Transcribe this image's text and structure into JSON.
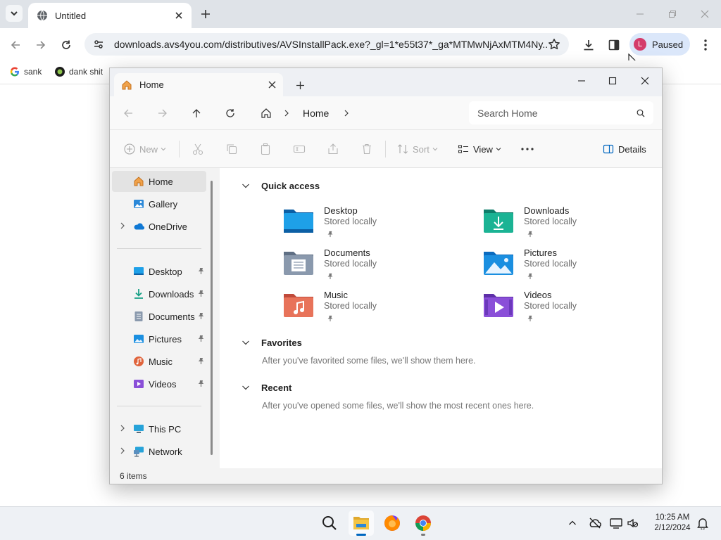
{
  "browser": {
    "tab_title": "Untitled",
    "url": "downloads.avs4you.com/distributives/AVSInstallPack.exe?_gl=1*e55t37*_ga*MTMwNjAxMTM4Ny...",
    "profile_initial": "L",
    "profile_status": "Paused",
    "bookmarks": [
      {
        "label": "sank",
        "icon": "google-icon"
      },
      {
        "label": "dank shit",
        "icon": "bookmark-site-icon"
      }
    ]
  },
  "explorer": {
    "tab_title": "Home",
    "breadcrumb": "Home",
    "search_placeholder": "Search Home",
    "commands": {
      "new": "New",
      "sort": "Sort",
      "view": "View",
      "details": "Details"
    },
    "sidebar": {
      "top": [
        {
          "label": "Home",
          "icon": "home-icon"
        },
        {
          "label": "Gallery",
          "icon": "gallery-icon"
        },
        {
          "label": "OneDrive",
          "icon": "onedrive-icon"
        }
      ],
      "pinned": [
        {
          "label": "Desktop",
          "icon": "desktop-icon"
        },
        {
          "label": "Downloads",
          "icon": "downloads-icon"
        },
        {
          "label": "Documents",
          "icon": "documents-icon"
        },
        {
          "label": "Pictures",
          "icon": "pictures-icon"
        },
        {
          "label": "Music",
          "icon": "music-icon"
        },
        {
          "label": "Videos",
          "icon": "videos-icon"
        }
      ],
      "bottom": [
        {
          "label": "This PC",
          "icon": "this-pc-icon"
        },
        {
          "label": "Network",
          "icon": "network-icon"
        }
      ]
    },
    "sections": {
      "quick_access": {
        "title": "Quick access",
        "items": [
          {
            "name": "Desktop",
            "status": "Stored locally"
          },
          {
            "name": "Downloads",
            "status": "Stored locally"
          },
          {
            "name": "Documents",
            "status": "Stored locally"
          },
          {
            "name": "Pictures",
            "status": "Stored locally"
          },
          {
            "name": "Music",
            "status": "Stored locally"
          },
          {
            "name": "Videos",
            "status": "Stored locally"
          }
        ]
      },
      "favorites": {
        "title": "Favorites",
        "message": "After you've favorited some files, we'll show them here."
      },
      "recent": {
        "title": "Recent",
        "message": "After you've opened some files, we'll show the most recent ones here."
      }
    },
    "status": "6 items"
  },
  "taskbar": {
    "time": "10:25 AM",
    "date": "2/12/2024"
  },
  "colors": {
    "accent": "#0067c0",
    "chrome_frame": "#dfe3e8",
    "profile_avatar": "#d43c6b"
  }
}
